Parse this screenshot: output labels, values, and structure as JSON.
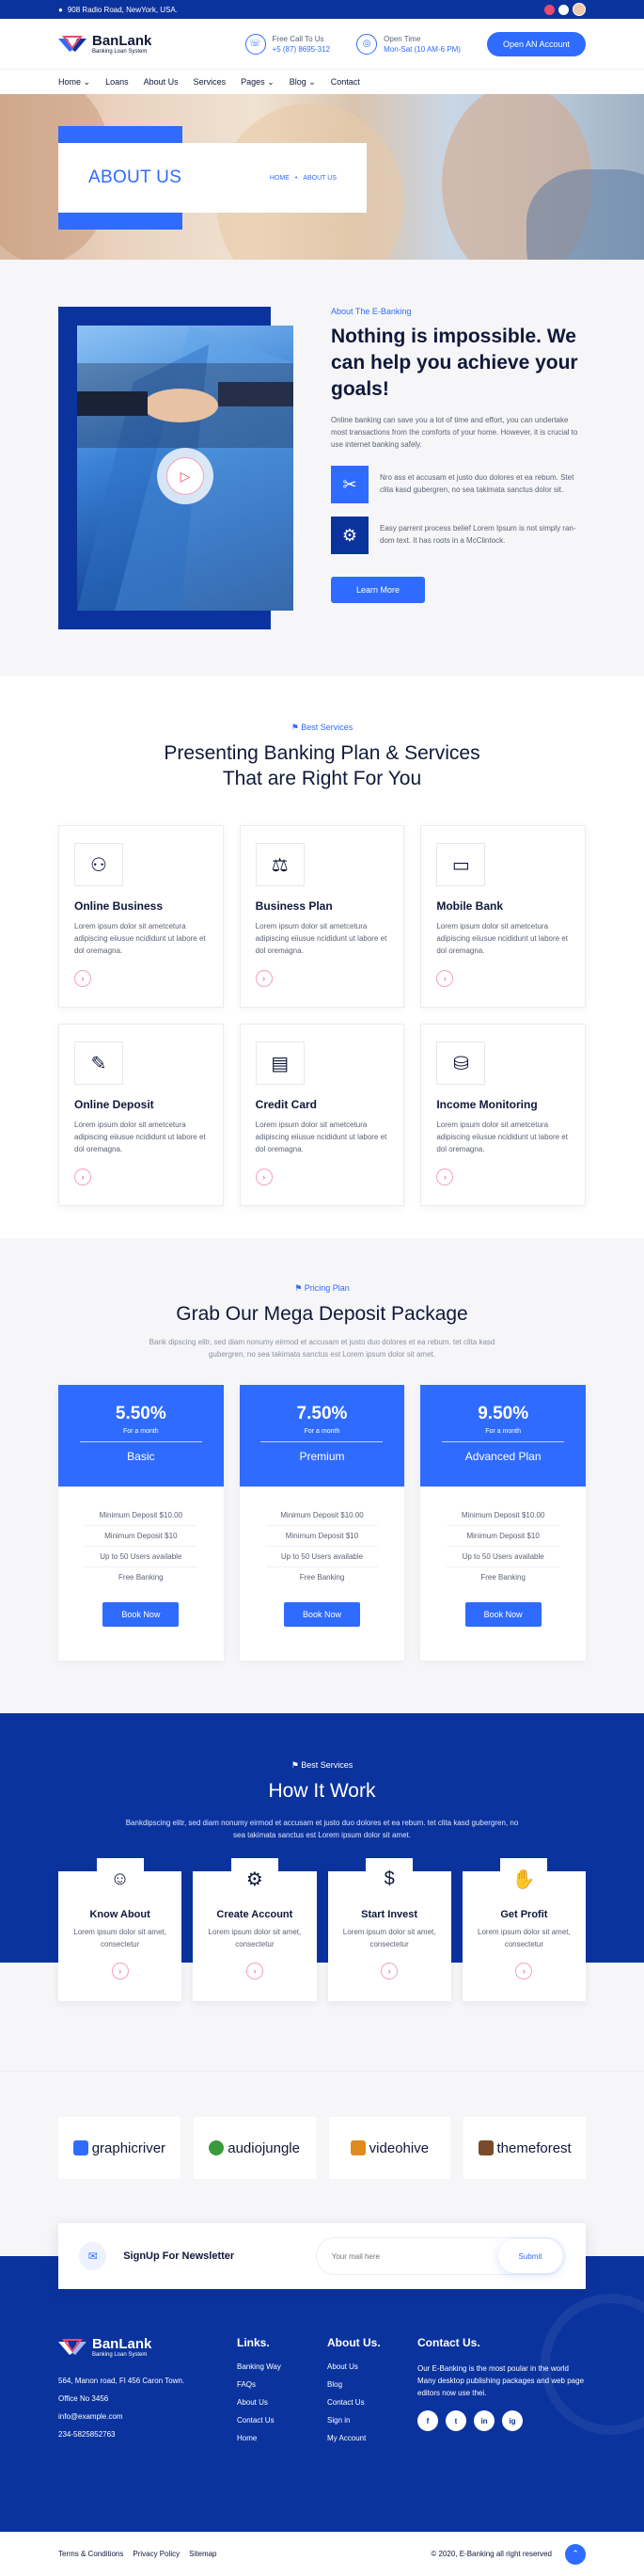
{
  "topbar": {
    "address": "908 Radio Road, NewYork, USA."
  },
  "colors": {
    "brand_blue": "#0b339e",
    "accent_blue": "#2f6bff",
    "accent_pink": "#e84b6e",
    "text_dark": "#10183a",
    "bg_light": "#f6f6f8"
  },
  "header": {
    "logo_name": "BanLank",
    "logo_tag": "Banking Loan System",
    "call_label": "Free Call To Us",
    "call_value": "+5 (87) 8695-312",
    "open_label": "Open Time",
    "open_value": "Mon-Sat (10 AM-6 PM)",
    "cta": "Open AN Account"
  },
  "nav": [
    "Home ⌄",
    "Loans",
    "About Us",
    "Services",
    "Pages ⌄",
    "Blog ⌄",
    "Contact"
  ],
  "hero": {
    "title": "ABOUT US",
    "crumb_home": "HOME",
    "crumb_sep": "•",
    "crumb_current": "ABOUT US"
  },
  "about": {
    "kicker": "About The E-Banking",
    "title": "Nothing is impossible. We can help you achieve your goals!",
    "desc": "Online banking can save you a lot of time and effort, you can undertake most transactions from the comforts of your home. However, it is crucial to use internet banking safely.",
    "features": [
      {
        "icon": "tools-icon",
        "text": "Nro ass et accusam et justo duo dolores et ea rebum. Stet clita kasd gubergren, no sea takimata sanctus dolor sit."
      },
      {
        "icon": "support-icon",
        "text": "Easy parrent process belief Lorem Ipsum is not simply ran-dom text. It has roots in a McClintock."
      }
    ],
    "button": "Learn More"
  },
  "services": {
    "kicker": "Best Services",
    "title_line1": "Presenting Banking Plan & Services",
    "title_line2": "That are Right For You",
    "items": [
      {
        "title": "Online Business",
        "text": "Lorem ipsum dolor sit ametcetura adipiscing eiiusue ncididunt ut labore et dol oremagna.",
        "icon": "network-icon"
      },
      {
        "title": "Business Plan",
        "text": "Lorem ipsum dolor sit ametcetura adipiscing eiiusue ncididunt ut labore et dol oremagna.",
        "icon": "chart-icon"
      },
      {
        "title": "Mobile Bank",
        "text": "Lorem ipsum dolor sit ametcetura adipiscing eiiusue ncididunt ut labore et dol oremagna.",
        "icon": "mobile-icon"
      },
      {
        "title": "Online Deposit",
        "text": "Lorem ipsum dolor sit ametcetura adipiscing eiiusue ncididunt ut labore et dol oremagna.",
        "icon": "deposit-icon"
      },
      {
        "title": "Credit Card",
        "text": "Lorem ipsum dolor sit ametcetura adipiscing eiiusue ncididunt ut labore et dol oremagna.",
        "icon": "credit-card-icon"
      },
      {
        "title": "Income Monitoring",
        "text": "Lorem ipsum dolor sit ametcetura adipiscing eiiusue ncididunt ut labore et dol oremagna.",
        "icon": "monitor-icon"
      }
    ]
  },
  "pricing": {
    "kicker": "Pricing Plan",
    "title": "Grab Our Mega Deposit Package",
    "sub": "Bank dipscing elitr, sed diam nonumy eirmod et accusam et justo duo dolores et ea rebum. tet clita kasd gubergren, no sea takimata sanctus est Lorem ipsum dolor sit amet.",
    "plans": [
      {
        "rate": "5.50%",
        "per": "For a month",
        "name": "Basic",
        "features": [
          "Minimum Deposit $10.00",
          "Minimum Deposit $10",
          "Up to 50 Users available",
          "Free Banking"
        ],
        "button": "Book Now"
      },
      {
        "rate": "7.50%",
        "per": "For a month",
        "name": "Premium",
        "features": [
          "Minimum Deposit $10.00",
          "Minimum Deposit $10",
          "Up to 50 Users available",
          "Free Banking"
        ],
        "button": "Book Now"
      },
      {
        "rate": "9.50%",
        "per": "For a month",
        "name": "Advanced Plan",
        "features": [
          "Minimum Deposit $10.00",
          "Minimum Deposit $10",
          "Up to 50 Users available",
          "Free Banking"
        ],
        "button": "Book Now"
      }
    ]
  },
  "how": {
    "kicker": "Best Services",
    "title": "How It Work",
    "sub": "Bankdipscing elitr, sed diam nonumy eirmod et accusam et justo duo dolores et ea rebum. tet clita kasd gubergren, no sea takimata sanctus est Lorem ipsum dolor sit amet.",
    "steps": [
      {
        "title": "Know About",
        "text": "Lorem ipsum dolor sit amet, consectetur",
        "icon": "user-icon"
      },
      {
        "title": "Create Account",
        "text": "Lorem ipsum dolor sit amet, consectetur",
        "icon": "user-settings-icon"
      },
      {
        "title": "Start Invest",
        "text": "Lorem ipsum dolor sit amet, consectetur",
        "icon": "invest-icon"
      },
      {
        "title": "Get Profit",
        "text": "Lorem ipsum dolor sit amet, consectetur",
        "icon": "profit-icon"
      }
    ]
  },
  "partners": [
    "graphicriver",
    "audiojungle",
    "videohive",
    "themeforest"
  ],
  "newsletter": {
    "title": "SignUp For Newsletter",
    "placeholder": "Your mail here",
    "button": "Submit"
  },
  "footer": {
    "logo_name": "BanLank",
    "logo_tag": "Banking Loan System",
    "address": "564, Manon road, Fl 456 Caron Town.",
    "office": "Office No 3456",
    "email": "info@example.com",
    "phone": "234-5825852763",
    "links_title": "Links.",
    "links": [
      "Banking Way",
      "FAQs",
      "About Us",
      "Contact Us",
      "Home"
    ],
    "about_title": "About Us.",
    "about_links": [
      "About Us",
      "Blog",
      "Contact Us",
      "Sign in",
      "My Account"
    ],
    "contact_title": "Contact Us.",
    "contact_text": "Our E-Banking is the most poular in the world Many desktop publishing packages and web page editors now use thei.",
    "socials": [
      "f",
      "t",
      "in",
      "ig"
    ]
  },
  "bottom": {
    "links": [
      "Terms & Conditions",
      "Privacy Policy",
      "Sitemap"
    ],
    "copyright": "© 2020, E-Banking all right reserved"
  }
}
